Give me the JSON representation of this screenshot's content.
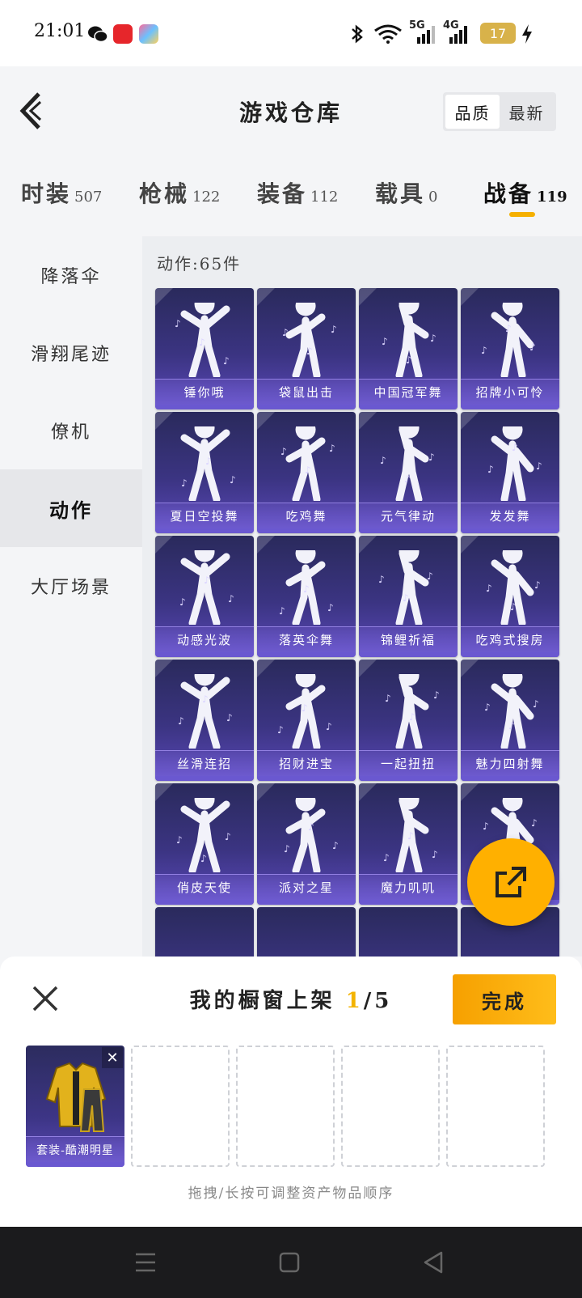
{
  "status": {
    "time": "21:01",
    "battery": "17",
    "net5g": "5G",
    "net4g": "4G"
  },
  "header": {
    "title": "游戏仓库",
    "sort_options": [
      "品质",
      "最新"
    ]
  },
  "tabs": [
    {
      "label": "时装",
      "count": "507"
    },
    {
      "label": "枪械",
      "count": "122"
    },
    {
      "label": "装备",
      "count": "112"
    },
    {
      "label": "载具",
      "count": "0"
    },
    {
      "label": "战备",
      "count": "119",
      "active": true
    }
  ],
  "sidebar": {
    "items": [
      "降落伞",
      "滑翔尾迹",
      "僚机",
      "动作",
      "大厅场景"
    ],
    "active": "动作"
  },
  "content": {
    "count_text": "动作:65件",
    "items": [
      "锤你哦",
      "袋鼠出击",
      "中国冠军舞",
      "招牌小可怜",
      "夏日空投舞",
      "吃鸡舞",
      "元气律动",
      "发发舞",
      "动感光波",
      "落英伞舞",
      "锦鲤祈福",
      "吃鸡式搜房",
      "丝滑连招",
      "招财进宝",
      "一起扭扭",
      "魅力四射舞",
      "俏皮天使",
      "派对之星",
      "魔力叽叽",
      ""
    ]
  },
  "panel": {
    "title_prefix": "我的橱窗上架",
    "title_current": "1",
    "title_total": "/5",
    "done_label": "完成",
    "slot_item": "套装-酷潮明星",
    "hint": "拖拽/长按可调整资产物品顺序"
  },
  "colors": {
    "accent": "#ffb000",
    "card_top": "#2a2a5c",
    "card_bottom": "#5a48b8"
  }
}
